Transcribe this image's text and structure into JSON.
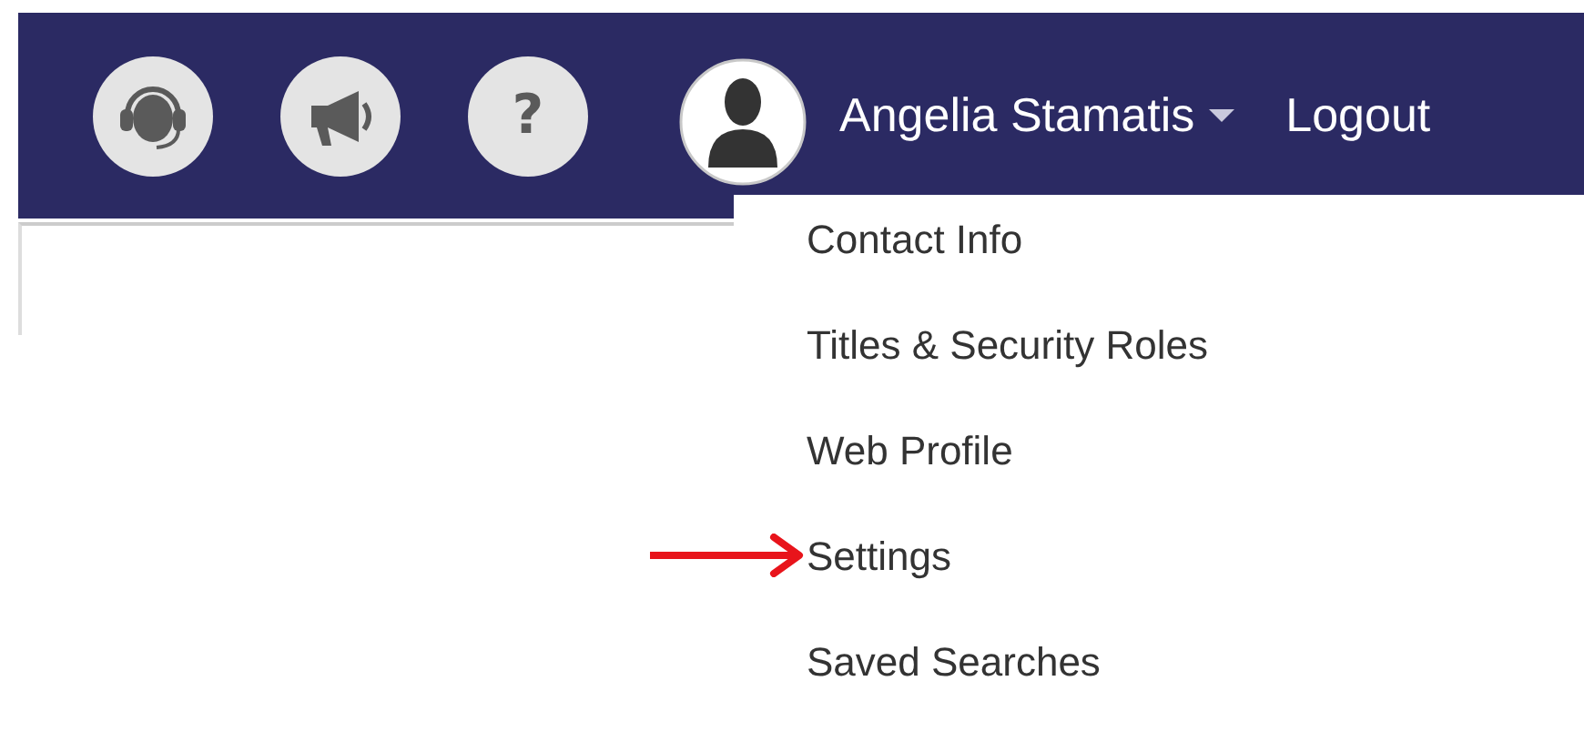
{
  "header": {
    "icons": [
      {
        "kind": "headset"
      },
      {
        "kind": "megaphone"
      },
      {
        "kind": "help",
        "glyph": "?"
      }
    ],
    "user": {
      "name": "Angelia Stamatis",
      "expanded": true
    },
    "logout": "Logout"
  },
  "user_menu": {
    "items": [
      {
        "label": "Contact Info",
        "marked": false
      },
      {
        "label": "Titles & Security Roles",
        "marked": false
      },
      {
        "label": "Web Profile",
        "marked": false
      },
      {
        "label": "Settings",
        "marked": true
      },
      {
        "label": "Saved Searches",
        "marked": false
      }
    ]
  }
}
